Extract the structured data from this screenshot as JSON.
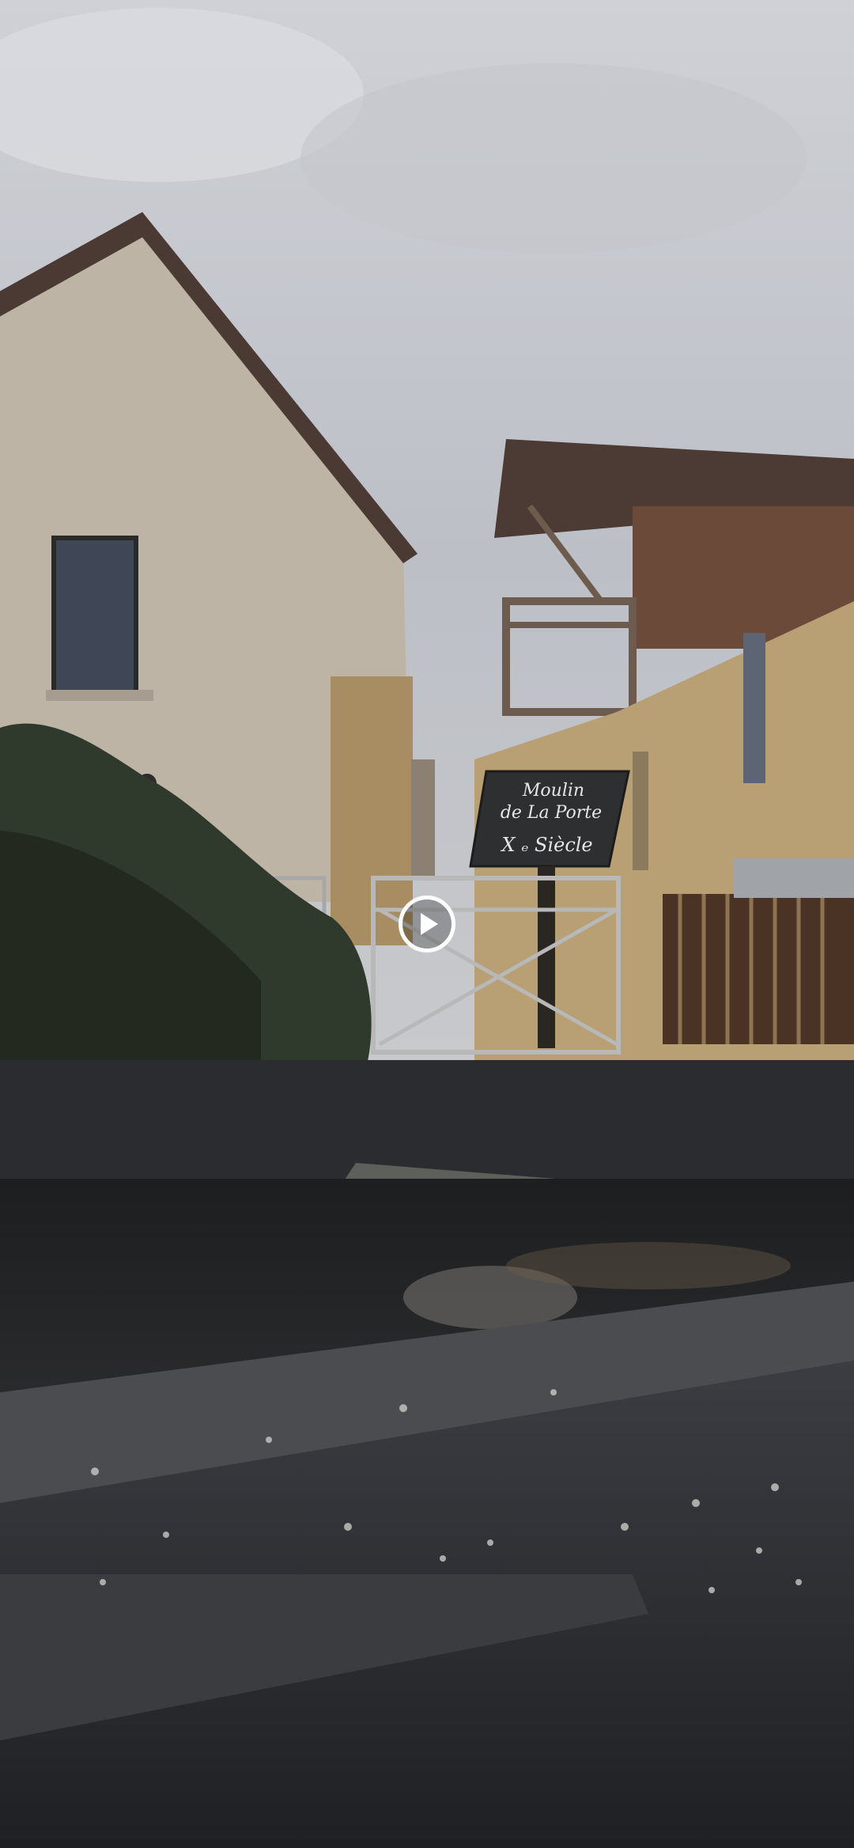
{
  "sign": {
    "line1": "Moulin",
    "line2": "de La Porte",
    "line3": "X ₑ Siècle"
  },
  "player": {
    "play_icon": "play-icon"
  }
}
